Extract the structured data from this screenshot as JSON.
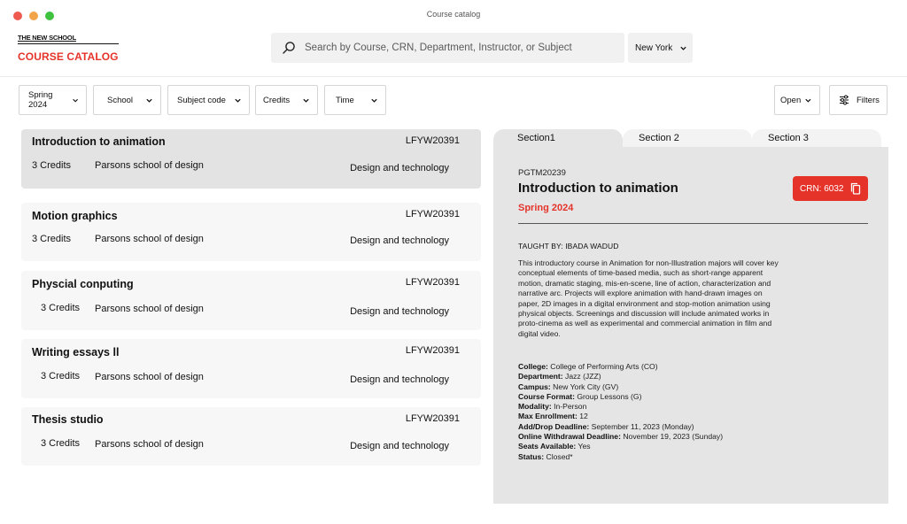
{
  "window": {
    "title": "Course catalog"
  },
  "brand": {
    "top": "THE NEW SCHOOL",
    "bottom": "COURSE CATALOG"
  },
  "search": {
    "placeholder": "Search by Course, CRN, Department, Instructor, or Subject"
  },
  "location": {
    "value": "New York"
  },
  "filters": {
    "term": "Spring 2024",
    "school": "School",
    "subject": "Subject code",
    "credits": "Credits",
    "time": "Time",
    "status": "Open",
    "more": "Filters"
  },
  "courses": [
    {
      "title": "Introduction to animation",
      "code": "LFYW20391",
      "credits": "3 Credits",
      "school": "Parsons school of design",
      "dept": "Design and technology"
    },
    {
      "title": "Motion graphics",
      "code": "LFYW20391",
      "credits": "3 Credits",
      "school": "Parsons school of design",
      "dept": "Design and technology"
    },
    {
      "title": "Physcial conputing",
      "code": "LFYW20391",
      "credits": "3 Credits",
      "school": "Parsons school of design",
      "dept": "Design and technology"
    },
    {
      "title": "Writing essays ll",
      "code": "LFYW20391",
      "credits": "3 Credits",
      "school": "Parsons school of design",
      "dept": "Design and technology"
    },
    {
      "title": "Thesis studio",
      "code": "LFYW20391",
      "credits": "3 Credits",
      "school": "Parsons school of design",
      "dept": "Design and technology"
    }
  ],
  "detail": {
    "tabs": [
      "Section1",
      "Section 2",
      "Section 3"
    ],
    "code": "PGTM20239",
    "title": "Introduction to animation",
    "term": "Spring 2024",
    "crn": "CRN: 6032",
    "taught_by": "TAUGHT BY: IBADA WADUD",
    "description": "This introductory course in Animation for non-Illustration majors will cover key conceptual elements of time-based media, such as short-range apparent motion, dramatic staging, mis-en-scene, line of action, characterization and narrative arc. Projects will explore animation with hand-drawn images on paper, 2D images in a digital environment and stop-motion animation using physical objects. Screenings and discussion will include animated works in proto-cinema as well as experimental and commercial animation in film and digital video.",
    "facts": [
      {
        "label": "College:",
        "value": "College of Performing Arts (CO)"
      },
      {
        "label": "Department:",
        "value": "Jazz (JZZ)"
      },
      {
        "label": "Campus:",
        "value": "New York City (GV)"
      },
      {
        "label": "Course Format:",
        "value": "Group Lessons (G)"
      },
      {
        "label": "Modality:",
        "value": "In-Person"
      },
      {
        "label": "Max Enrollment:",
        "value": "12"
      },
      {
        "label": "Add/Drop Deadline:",
        "value": "September 11, 2023 (Monday)"
      },
      {
        "label": "Online Withdrawal Deadline:",
        "value": "November 19, 2023 (Sunday)"
      },
      {
        "label": "Seats Available:",
        "value": "Yes"
      },
      {
        "label": "Status:",
        "value": "Closed*"
      }
    ]
  }
}
